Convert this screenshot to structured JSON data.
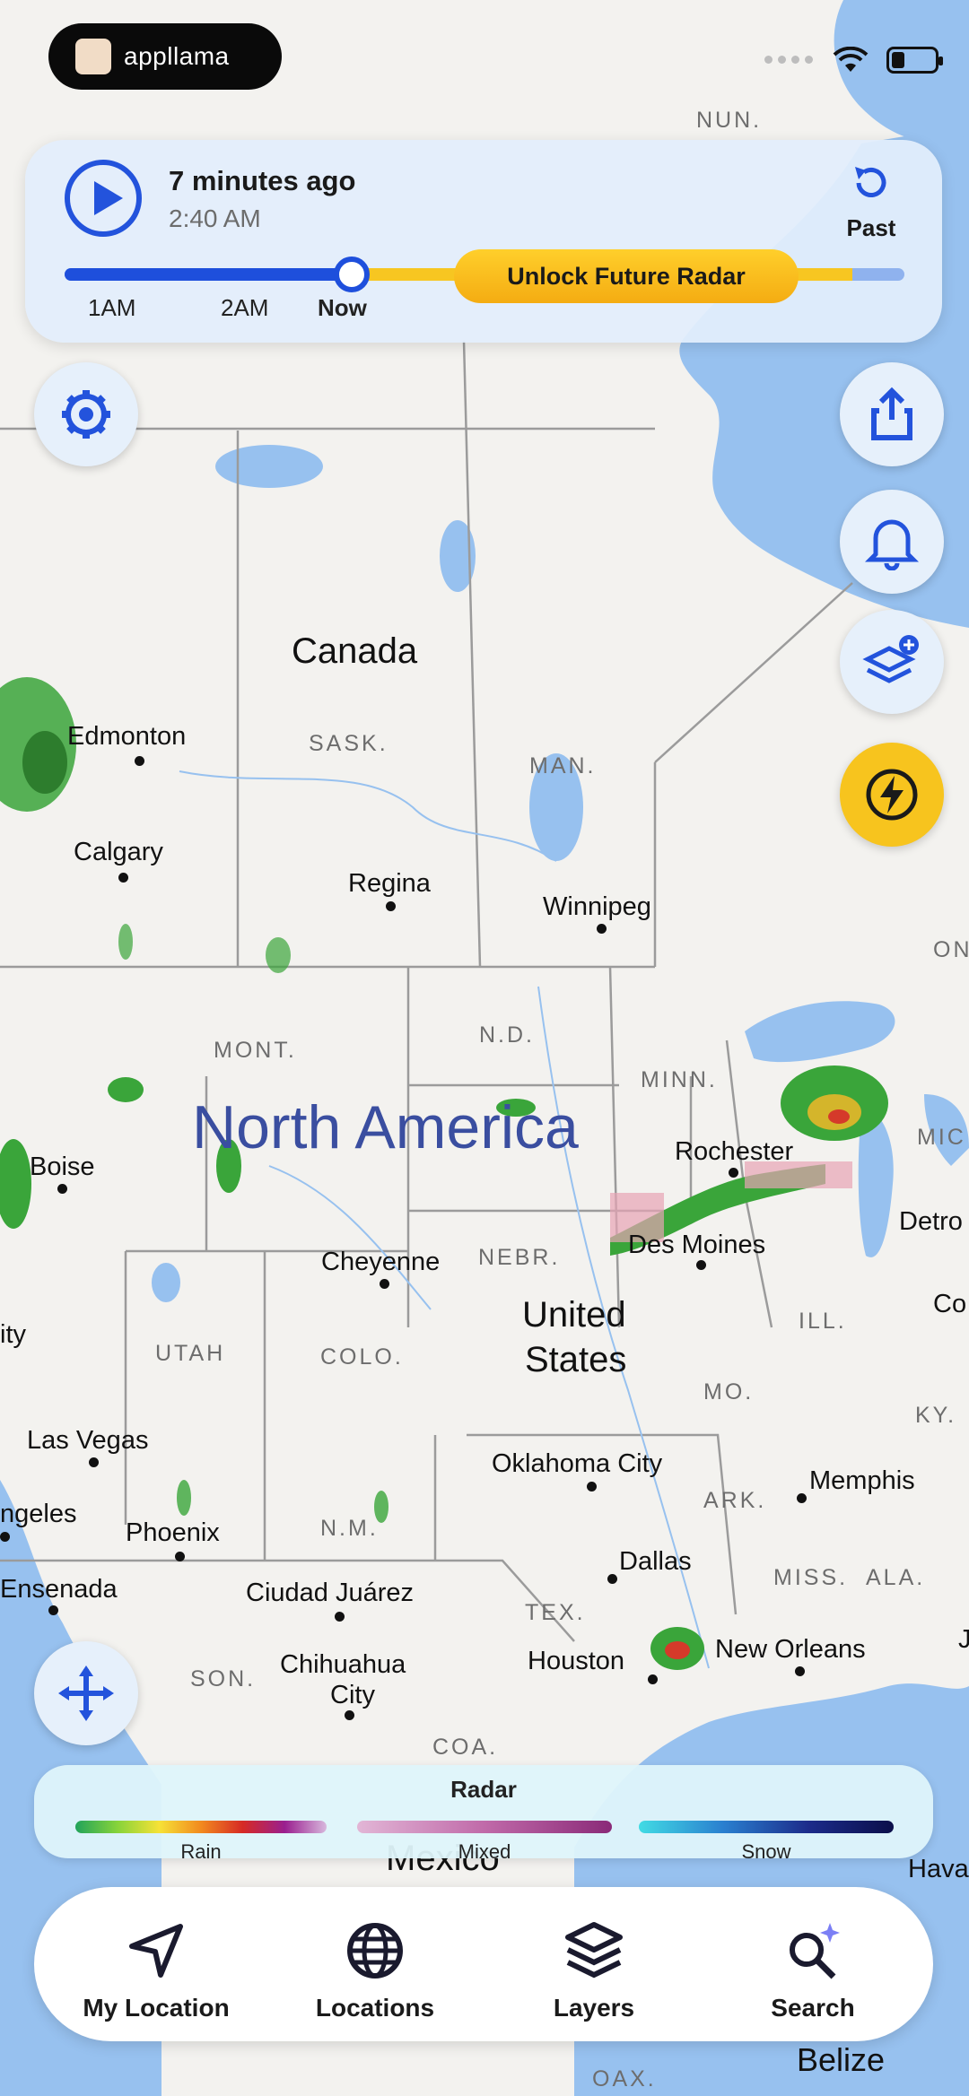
{
  "app": {
    "name": "appllama"
  },
  "radar": {
    "ago": "7 minutes ago",
    "time": "2:40 AM",
    "past_label": "Past",
    "unlock_label": "Unlock Future Radar",
    "timeline_labels": [
      "1AM",
      "2AM",
      "Now"
    ]
  },
  "map": {
    "region_label": "North America",
    "countries": {
      "canada": "Canada",
      "us_line1": "United",
      "us_line2": "States",
      "mexico": "Mexico",
      "belize": "Belize"
    },
    "provinces": {
      "sask": "SASK.",
      "man": "MAN.",
      "mont": "MONT.",
      "nd": "N.D.",
      "minn": "MINN.",
      "nebr": "NEBR.",
      "utah": "UTAH",
      "colo": "COLO.",
      "ill": "ILL.",
      "mo": "MO.",
      "ky": "KY.",
      "ark": "ARK.",
      "miss": "MISS.",
      "ala": "ALA.",
      "nm": "N.M.",
      "tex": "TEX.",
      "son": "SON.",
      "coa": "COA.",
      "nun": "NUN.",
      "on": "ON",
      "mic": "MIC",
      "oax": "OAX."
    },
    "cities": {
      "edmonton": "Edmonton",
      "calgary": "Calgary",
      "regina": "Regina",
      "winnipeg": "Winnipeg",
      "rochester": "Rochester",
      "boise": "Boise",
      "cheyenne": "Cheyenne",
      "des_moines": "Des Moines",
      "detroit": "Detro",
      "city_left": "ity",
      "co_right": "Co",
      "las_vegas": "Las Vegas",
      "angeles": "ngeles",
      "phoenix": "Phoenix",
      "oklahoma": "Oklahoma City",
      "memphis": "Memphis",
      "ensenada": "Ensenada",
      "ciudad_juarez": "Ciudad Juárez",
      "dallas": "Dallas",
      "chihuahua_1": "Chihuahua",
      "chihuahua_2": "City",
      "houston": "Houston",
      "new_orleans": "New Orleans",
      "j_right": "J",
      "hava": "Hava"
    }
  },
  "legend": {
    "title": "Radar",
    "rain": "Rain",
    "mixed": "Mixed",
    "snow": "Snow"
  },
  "nav": {
    "my_location": "My Location",
    "locations": "Locations",
    "layers": "Layers",
    "search": "Search"
  },
  "colors": {
    "accent": "#2353DC",
    "future": "#F7C621",
    "water": "#97C1EF",
    "land": "#F3F2EF"
  }
}
